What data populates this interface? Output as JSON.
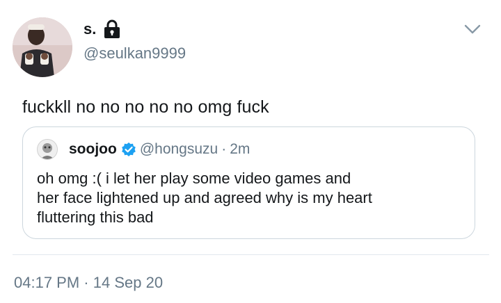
{
  "author": {
    "display_name": "s.",
    "handle": "@seulkan9999",
    "protected": true
  },
  "tweet": {
    "text": "fuckkll no no no no no omg fuck"
  },
  "quoted_tweet": {
    "display_name": "soojoo",
    "verified": true,
    "handle": "@hongsuzu",
    "separator": "·",
    "time": "2m",
    "lines": [
      "oh omg :( i let her play some video games and",
      "her face lightened up and agreed why is my heart",
      "fluttering this bad"
    ]
  },
  "meta": {
    "time": "04:17 PM",
    "separator": "·",
    "date": "14 Sep 20"
  },
  "colors": {
    "primary_text": "#14171a",
    "secondary_text": "#657786",
    "verified_blue": "#1da1f2",
    "border": "#ccd6dd"
  },
  "icons": [
    "lock-icon",
    "chevron-down-icon",
    "verified-icon"
  ]
}
